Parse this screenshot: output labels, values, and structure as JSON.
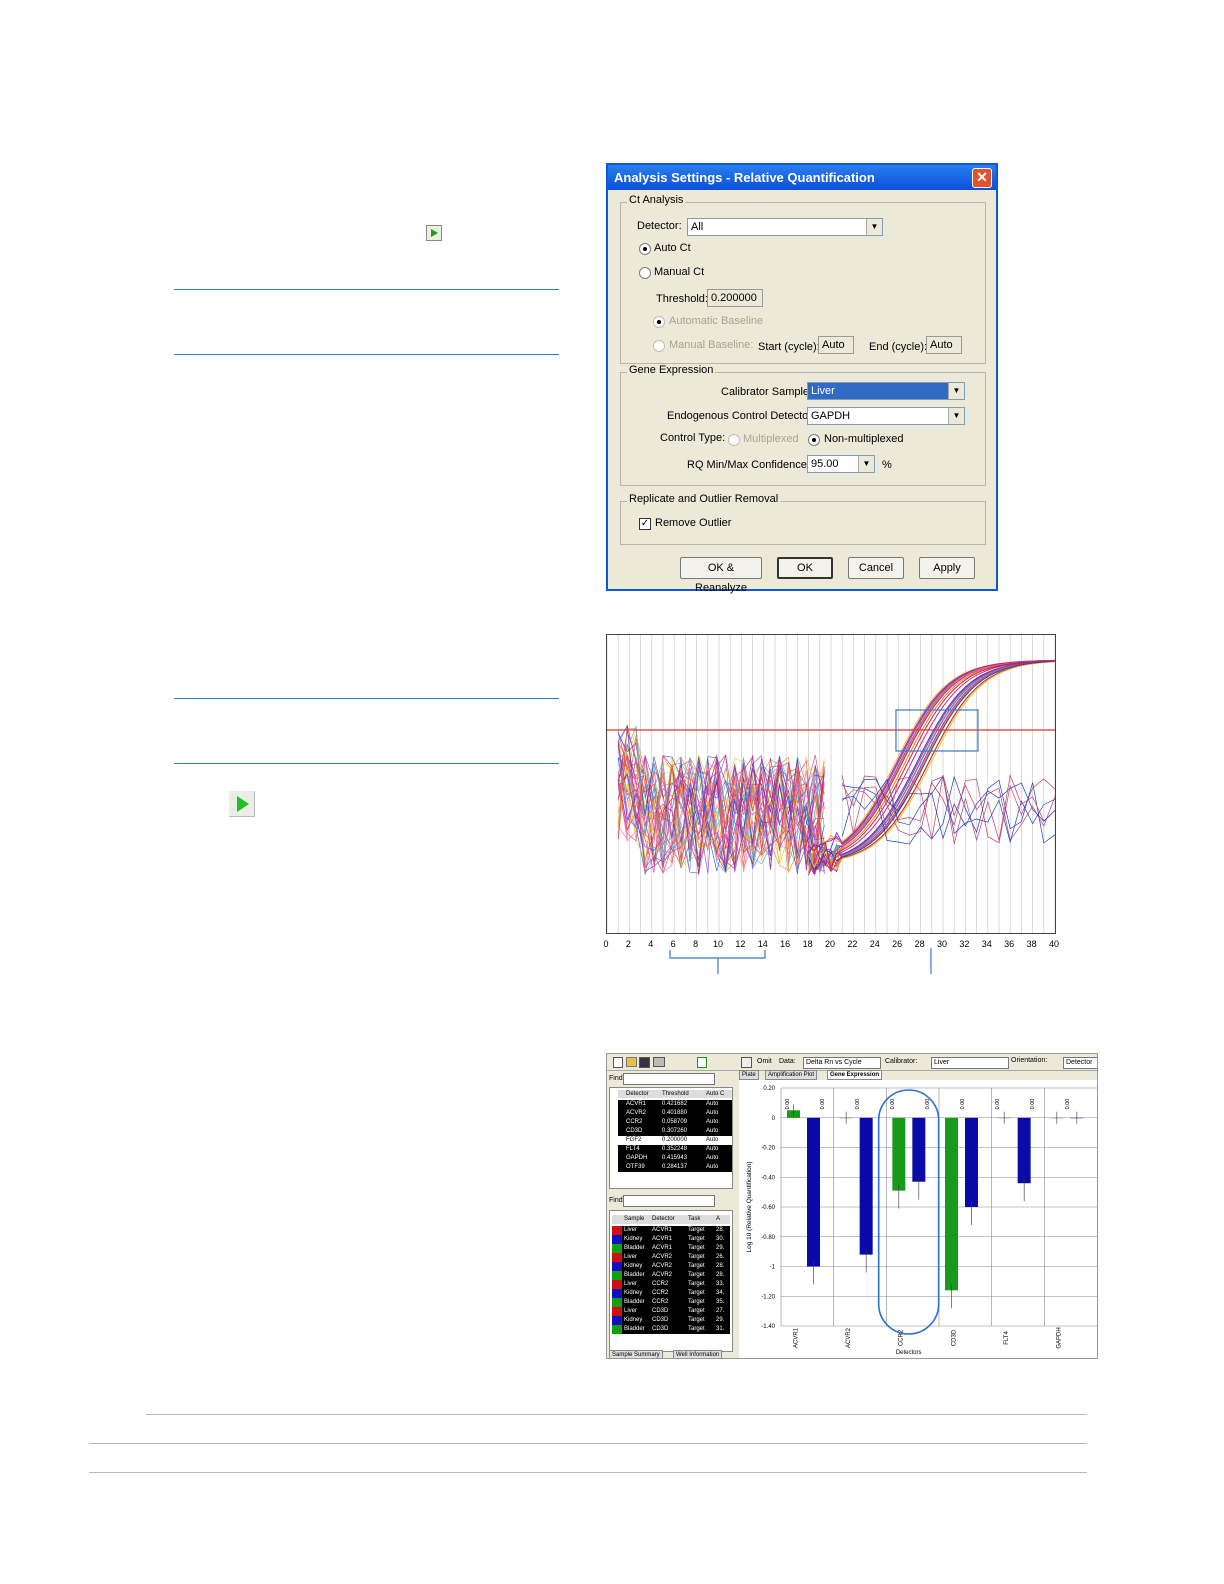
{
  "dialog": {
    "title": "Analysis Settings - Relative Quantification",
    "close_glyph": "✕",
    "ct_analysis": {
      "group_title": "Ct Analysis",
      "detector_label": "Detector:",
      "detector_value": "All",
      "auto_ct_label": "Auto Ct",
      "manual_ct_label": "Manual Ct",
      "threshold_label": "Threshold:",
      "threshold_value": "0.200000",
      "automatic_baseline_label": "Automatic Baseline",
      "manual_baseline_label": "Manual Baseline:",
      "start_cycle_label": "Start (cycle):",
      "start_cycle_value": "Auto",
      "end_cycle_label": "End (cycle):",
      "end_cycle_value": "Auto"
    },
    "gene_expression": {
      "group_title": "Gene Expression",
      "calibrator_label": "Calibrator Sample",
      "calibrator_value": "Liver",
      "endogenous_label": "Endogenous Control Detector",
      "endogenous_value": "GAPDH",
      "control_type_label": "Control Type:",
      "multiplexed_label": "Multiplexed",
      "non_multiplexed_label": "Non-multiplexed",
      "rq_label": "RQ Min/Max Confidence",
      "rq_value": "95.00",
      "rq_unit": "%"
    },
    "replicate": {
      "group_title": "Replicate and Outlier Removal",
      "remove_outlier_label": "Remove Outlier",
      "remove_outlier_checked": true
    },
    "buttons": {
      "ok_reanalyze": "OK & Reanalyze",
      "ok": "OK",
      "cancel": "Cancel",
      "apply": "Apply"
    }
  },
  "amplification_plot": {
    "x_ticks": [
      "0",
      "2",
      "4",
      "6",
      "8",
      "10",
      "12",
      "14",
      "16",
      "18",
      "20",
      "22",
      "24",
      "26",
      "28",
      "30",
      "32",
      "34",
      "36",
      "38",
      "40"
    ],
    "threshold_color": "#e03030"
  },
  "gene_expression_window": {
    "toolbar": {
      "omit_label": "Omit",
      "data_label": "Data:",
      "data_value": "Delta Rn vs Cycle",
      "calibrator_label": "Calibrator:",
      "calibrator_value": "Liver",
      "orientation_label": "Orientation:",
      "orientation_value": "Detector"
    },
    "find_label": "Find:",
    "tabs": [
      "Plate",
      "Amplification Plot",
      "Gene Expression"
    ],
    "bottom_tabs": [
      "Sample Summary",
      "Well Information"
    ],
    "detector_table": {
      "headers": [
        "Detector",
        "Threshold",
        "Auto C"
      ],
      "rows": [
        [
          "ACVR1",
          "0.421682",
          "Auto"
        ],
        [
          "ACVR2",
          "0.401880",
          "Auto"
        ],
        [
          "CCR2",
          "0.058709",
          "Auto"
        ],
        [
          "CD3D",
          "0.307260",
          "Auto"
        ],
        [
          "FGF2",
          "0.200000",
          "Auto"
        ],
        [
          "FLT4",
          "0.352248",
          "Auto"
        ],
        [
          "GAPDH",
          "0.415943",
          "Auto"
        ],
        [
          "OTF39",
          "0.284137",
          "Auto"
        ]
      ]
    },
    "sample_table": {
      "headers": [
        "Sample",
        "Detector",
        "Task",
        "A"
      ],
      "rows": [
        [
          "Liver",
          "ACVR1",
          "Target",
          "28."
        ],
        [
          "Kidney",
          "ACVR1",
          "Target",
          "30."
        ],
        [
          "Bladder",
          "ACVR1",
          "Target",
          "29."
        ],
        [
          "Liver",
          "ACVR2",
          "Target",
          "26."
        ],
        [
          "Kidney",
          "ACVR2",
          "Target",
          "28."
        ],
        [
          "Bladder",
          "ACVR2",
          "Target",
          "28."
        ],
        [
          "Liver",
          "CCR2",
          "Target",
          "33."
        ],
        [
          "Kidney",
          "CCR2",
          "Target",
          "34."
        ],
        [
          "Bladder",
          "CCR2",
          "Target",
          "35."
        ],
        [
          "Liver",
          "CD3D",
          "Target",
          "27."
        ],
        [
          "Kidney",
          "CD3D",
          "Target",
          "29."
        ],
        [
          "Bladder",
          "CD3D",
          "Target",
          "31."
        ]
      ],
      "row_colors": [
        "#d01010",
        "#1010c0",
        "#10a010",
        "#d01010",
        "#1010c0",
        "#10a010",
        "#d01010",
        "#1010c0",
        "#10a010",
        "#d01010",
        "#1010c0",
        "#10a010"
      ]
    }
  },
  "chart_data": {
    "type": "bar",
    "ylabel": "Log 10 (Relative Quantification)",
    "xlabel": "Detectors",
    "ylim": [
      -1.4,
      0.2
    ],
    "y_ticks": [
      "0.20",
      "0",
      "-0.20",
      "-0.40",
      "-0.60",
      "-0.80",
      "-1",
      "-1.20",
      "-1.40"
    ],
    "categories": [
      "ACVR1",
      "ACVR2",
      "CCR2",
      "CD3D",
      "FLT4",
      "GAPDH"
    ],
    "series": [
      {
        "color": "#1a9a1a",
        "values": [
          0.05,
          0.0,
          -0.49,
          -1.16,
          0.0,
          0.0
        ]
      },
      {
        "color": "#0a0aa8",
        "values": [
          -1.0,
          -0.92,
          -0.43,
          -0.6,
          -0.44,
          0.0
        ]
      }
    ],
    "value_labels": [
      "0.00",
      "0.00",
      "0.00",
      "0.00",
      "0.00",
      "0.00",
      "0.00",
      "0.00",
      "0.00"
    ],
    "highlight_category": "CCR2"
  }
}
